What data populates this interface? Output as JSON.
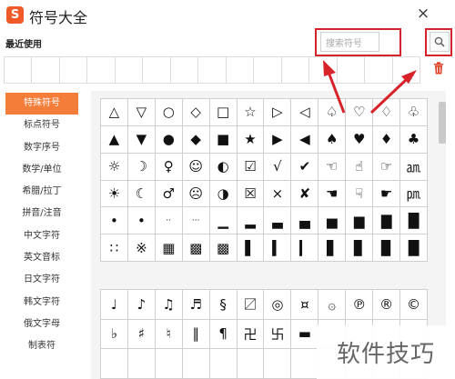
{
  "app": {
    "title": "符号大全",
    "logo_letter": "S",
    "close_glyph": "×",
    "accent_color": "#f47d3a",
    "highlight_color": "#d8222a"
  },
  "recent": {
    "label": "最近使用"
  },
  "search": {
    "placeholder": "搜索符号",
    "button_icon": "magnifier-icon"
  },
  "trash": {
    "icon": "trash-icon"
  },
  "sidebar": {
    "items": [
      {
        "label": "特殊符号",
        "active": true
      },
      {
        "label": "标点符号",
        "active": false
      },
      {
        "label": "数字序号",
        "active": false
      },
      {
        "label": "数学/单位",
        "active": false
      },
      {
        "label": "希腊/拉丁",
        "active": false
      },
      {
        "label": "拼音/注音",
        "active": false
      },
      {
        "label": "中文字符",
        "active": false
      },
      {
        "label": "英文音标",
        "active": false
      },
      {
        "label": "日文字符",
        "active": false
      },
      {
        "label": "韩文字符",
        "active": false
      },
      {
        "label": "俄文字母",
        "active": false
      },
      {
        "label": "制表符",
        "active": false
      }
    ]
  },
  "symbols": {
    "grid1": [
      "△",
      "▽",
      "○",
      "◇",
      "□",
      "☆",
      "▷",
      "◁",
      "♤",
      "♡",
      "♢",
      "♧",
      "▲",
      "▼",
      "●",
      "◆",
      "■",
      "★",
      "▶",
      "◀",
      "♠",
      "♥",
      "♦",
      "♣",
      "☼",
      "☽",
      "♀",
      "☺",
      "◐",
      "☑",
      "√",
      "✔",
      "☜",
      "☝",
      "☞",
      "㏂",
      "☀",
      "☾",
      "♂",
      "☹",
      "◑",
      "☒",
      "×",
      "✘",
      "☚",
      "☟",
      "☛",
      "㏘",
      "•",
      "•",
      "··",
      "···",
      "▁",
      "▂",
      "▃",
      "▄",
      "▅",
      "▆",
      "▇",
      "█",
      "∷",
      "※",
      "▦",
      "▩",
      "▩",
      "▌",
      "▍",
      "▎",
      "▋",
      "▊",
      "▉",
      "█"
    ],
    "grid2": [
      "♩",
      "♪",
      "♫",
      "♬",
      "§",
      "〼",
      "◎",
      "¤",
      "۞",
      "℗",
      "®",
      "©",
      "♭",
      "♯",
      "♮",
      "‖",
      "¶",
      "卍",
      "卐",
      "▬",
      "",
      "",
      "",
      "",
      "",
      "",
      "",
      "",
      "",
      "",
      "",
      "",
      "",
      "",
      "",
      ""
    ]
  },
  "watermark": {
    "text": "软件技巧"
  }
}
